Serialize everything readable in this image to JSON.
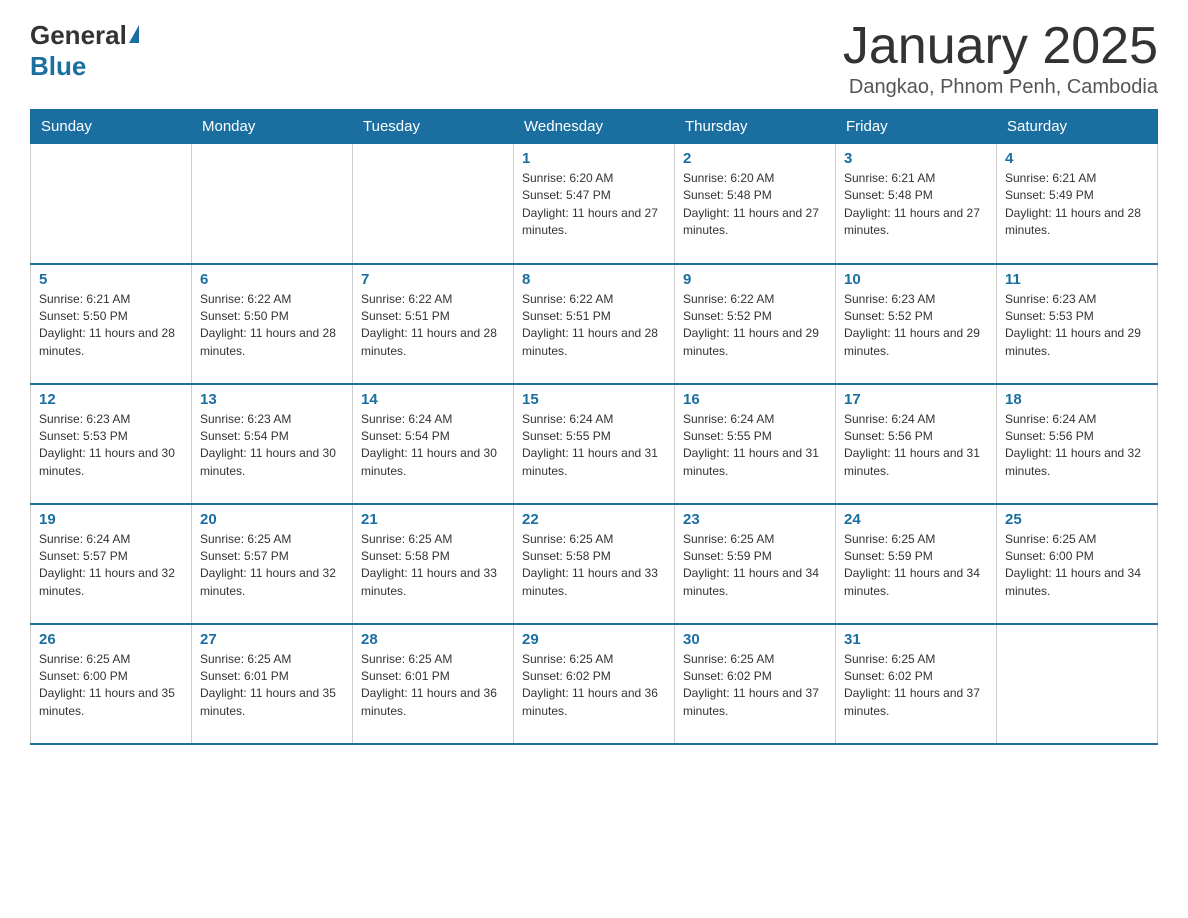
{
  "logo": {
    "general": "General",
    "blue": "Blue"
  },
  "header": {
    "month_year": "January 2025",
    "location": "Dangkao, Phnom Penh, Cambodia"
  },
  "days_of_week": [
    "Sunday",
    "Monday",
    "Tuesday",
    "Wednesday",
    "Thursday",
    "Friday",
    "Saturday"
  ],
  "weeks": [
    [
      {
        "day": "",
        "sunrise": "",
        "sunset": "",
        "daylight": ""
      },
      {
        "day": "",
        "sunrise": "",
        "sunset": "",
        "daylight": ""
      },
      {
        "day": "",
        "sunrise": "",
        "sunset": "",
        "daylight": ""
      },
      {
        "day": "1",
        "sunrise": "Sunrise: 6:20 AM",
        "sunset": "Sunset: 5:47 PM",
        "daylight": "Daylight: 11 hours and 27 minutes."
      },
      {
        "day": "2",
        "sunrise": "Sunrise: 6:20 AM",
        "sunset": "Sunset: 5:48 PM",
        "daylight": "Daylight: 11 hours and 27 minutes."
      },
      {
        "day": "3",
        "sunrise": "Sunrise: 6:21 AM",
        "sunset": "Sunset: 5:48 PM",
        "daylight": "Daylight: 11 hours and 27 minutes."
      },
      {
        "day": "4",
        "sunrise": "Sunrise: 6:21 AM",
        "sunset": "Sunset: 5:49 PM",
        "daylight": "Daylight: 11 hours and 28 minutes."
      }
    ],
    [
      {
        "day": "5",
        "sunrise": "Sunrise: 6:21 AM",
        "sunset": "Sunset: 5:50 PM",
        "daylight": "Daylight: 11 hours and 28 minutes."
      },
      {
        "day": "6",
        "sunrise": "Sunrise: 6:22 AM",
        "sunset": "Sunset: 5:50 PM",
        "daylight": "Daylight: 11 hours and 28 minutes."
      },
      {
        "day": "7",
        "sunrise": "Sunrise: 6:22 AM",
        "sunset": "Sunset: 5:51 PM",
        "daylight": "Daylight: 11 hours and 28 minutes."
      },
      {
        "day": "8",
        "sunrise": "Sunrise: 6:22 AM",
        "sunset": "Sunset: 5:51 PM",
        "daylight": "Daylight: 11 hours and 28 minutes."
      },
      {
        "day": "9",
        "sunrise": "Sunrise: 6:22 AM",
        "sunset": "Sunset: 5:52 PM",
        "daylight": "Daylight: 11 hours and 29 minutes."
      },
      {
        "day": "10",
        "sunrise": "Sunrise: 6:23 AM",
        "sunset": "Sunset: 5:52 PM",
        "daylight": "Daylight: 11 hours and 29 minutes."
      },
      {
        "day": "11",
        "sunrise": "Sunrise: 6:23 AM",
        "sunset": "Sunset: 5:53 PM",
        "daylight": "Daylight: 11 hours and 29 minutes."
      }
    ],
    [
      {
        "day": "12",
        "sunrise": "Sunrise: 6:23 AM",
        "sunset": "Sunset: 5:53 PM",
        "daylight": "Daylight: 11 hours and 30 minutes."
      },
      {
        "day": "13",
        "sunrise": "Sunrise: 6:23 AM",
        "sunset": "Sunset: 5:54 PM",
        "daylight": "Daylight: 11 hours and 30 minutes."
      },
      {
        "day": "14",
        "sunrise": "Sunrise: 6:24 AM",
        "sunset": "Sunset: 5:54 PM",
        "daylight": "Daylight: 11 hours and 30 minutes."
      },
      {
        "day": "15",
        "sunrise": "Sunrise: 6:24 AM",
        "sunset": "Sunset: 5:55 PM",
        "daylight": "Daylight: 11 hours and 31 minutes."
      },
      {
        "day": "16",
        "sunrise": "Sunrise: 6:24 AM",
        "sunset": "Sunset: 5:55 PM",
        "daylight": "Daylight: 11 hours and 31 minutes."
      },
      {
        "day": "17",
        "sunrise": "Sunrise: 6:24 AM",
        "sunset": "Sunset: 5:56 PM",
        "daylight": "Daylight: 11 hours and 31 minutes."
      },
      {
        "day": "18",
        "sunrise": "Sunrise: 6:24 AM",
        "sunset": "Sunset: 5:56 PM",
        "daylight": "Daylight: 11 hours and 32 minutes."
      }
    ],
    [
      {
        "day": "19",
        "sunrise": "Sunrise: 6:24 AM",
        "sunset": "Sunset: 5:57 PM",
        "daylight": "Daylight: 11 hours and 32 minutes."
      },
      {
        "day": "20",
        "sunrise": "Sunrise: 6:25 AM",
        "sunset": "Sunset: 5:57 PM",
        "daylight": "Daylight: 11 hours and 32 minutes."
      },
      {
        "day": "21",
        "sunrise": "Sunrise: 6:25 AM",
        "sunset": "Sunset: 5:58 PM",
        "daylight": "Daylight: 11 hours and 33 minutes."
      },
      {
        "day": "22",
        "sunrise": "Sunrise: 6:25 AM",
        "sunset": "Sunset: 5:58 PM",
        "daylight": "Daylight: 11 hours and 33 minutes."
      },
      {
        "day": "23",
        "sunrise": "Sunrise: 6:25 AM",
        "sunset": "Sunset: 5:59 PM",
        "daylight": "Daylight: 11 hours and 34 minutes."
      },
      {
        "day": "24",
        "sunrise": "Sunrise: 6:25 AM",
        "sunset": "Sunset: 5:59 PM",
        "daylight": "Daylight: 11 hours and 34 minutes."
      },
      {
        "day": "25",
        "sunrise": "Sunrise: 6:25 AM",
        "sunset": "Sunset: 6:00 PM",
        "daylight": "Daylight: 11 hours and 34 minutes."
      }
    ],
    [
      {
        "day": "26",
        "sunrise": "Sunrise: 6:25 AM",
        "sunset": "Sunset: 6:00 PM",
        "daylight": "Daylight: 11 hours and 35 minutes."
      },
      {
        "day": "27",
        "sunrise": "Sunrise: 6:25 AM",
        "sunset": "Sunset: 6:01 PM",
        "daylight": "Daylight: 11 hours and 35 minutes."
      },
      {
        "day": "28",
        "sunrise": "Sunrise: 6:25 AM",
        "sunset": "Sunset: 6:01 PM",
        "daylight": "Daylight: 11 hours and 36 minutes."
      },
      {
        "day": "29",
        "sunrise": "Sunrise: 6:25 AM",
        "sunset": "Sunset: 6:02 PM",
        "daylight": "Daylight: 11 hours and 36 minutes."
      },
      {
        "day": "30",
        "sunrise": "Sunrise: 6:25 AM",
        "sunset": "Sunset: 6:02 PM",
        "daylight": "Daylight: 11 hours and 37 minutes."
      },
      {
        "day": "31",
        "sunrise": "Sunrise: 6:25 AM",
        "sunset": "Sunset: 6:02 PM",
        "daylight": "Daylight: 11 hours and 37 minutes."
      },
      {
        "day": "",
        "sunrise": "",
        "sunset": "",
        "daylight": ""
      }
    ]
  ]
}
